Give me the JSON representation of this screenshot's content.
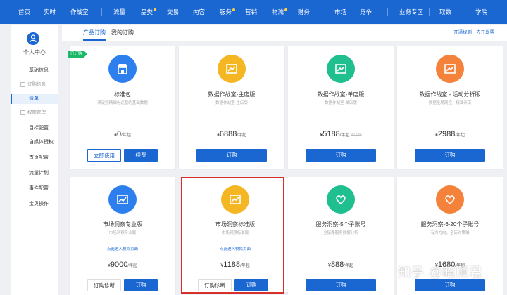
{
  "nav": {
    "items": [
      "首页",
      "实时",
      "作战室",
      "流量",
      "品类",
      "交易",
      "内容",
      "服务",
      "营销",
      "物流",
      "财务",
      "市场",
      "竞争",
      "业务专区",
      "取数",
      "学院"
    ]
  },
  "sidebar": {
    "user_label": "个人中心",
    "basic_info": "基础信息",
    "order_group": "订购信息",
    "order_item": "清单",
    "settings_group": "权限管理",
    "items": [
      "目标配置",
      "自媒体授权",
      "首页配置",
      "流量计划",
      "事件配置",
      "宝贝操作"
    ]
  },
  "header": {
    "tab_products": "产品订购",
    "tab_my_orders": "我的订购",
    "link_rules": "开通规则",
    "link_invoice": "去开发票"
  },
  "cards": [
    {
      "badge": "已订购",
      "title": "标准包",
      "sub": "满足您精细化运营的基础数据",
      "currency": "¥",
      "price": "0",
      "unit": "/年起",
      "btn_left": "立即使用",
      "btn_right": "续费",
      "icon": "store-icon",
      "color": "#2d7fee"
    },
    {
      "title": "数据作战室-主店版",
      "sub": "数据作战室·主店版",
      "currency": "¥",
      "price": "6888",
      "unit": "/年起",
      "btn": "订购",
      "icon": "chart-icon",
      "color": "#f4b623"
    },
    {
      "title": "数据作战室-单店版",
      "sub": "数据作战室·单店版",
      "currency": "¥",
      "price": "5188",
      "unit": "/年起",
      "old_price": "¥6,188",
      "btn": "订购",
      "icon": "chart-icon",
      "color": "#1fbf8f"
    },
    {
      "title": "数据作战室 - 活动分析版",
      "sub": "数据全局观控，精准开店",
      "currency": "¥",
      "price": "2988",
      "unit": "/年起",
      "btn": "订购",
      "icon": "chart-icon",
      "color": "#f5823a"
    },
    {
      "title": "市场洞察专业版",
      "sub": "市场洞察专业版",
      "link": "点此进入模拟页面",
      "currency": "¥",
      "price": "9000",
      "unit": "/年起",
      "btn_left": "订购诊断",
      "btn_right": "订购",
      "icon": "trend-icon",
      "color": "#2d7fee"
    },
    {
      "title": "市场洞察标准版",
      "sub": "市场洞察标准版",
      "link": "点此进入模拟页面",
      "currency": "¥",
      "price": "1188",
      "unit": "/年起",
      "btn_left": "订购诊断",
      "btn_right": "订购",
      "icon": "chart-icon",
      "color": "#f4b623"
    },
    {
      "title": "服务洞察-5个子账号",
      "sub": "全链路服务数据分析",
      "currency": "¥",
      "price": "888",
      "unit": "/年起",
      "btn": "订购",
      "icon": "heart-icon",
      "color": "#1fbf8f"
    },
    {
      "title": "服务洞察-6-20个子账号",
      "sub": "有力方向，全店对策略",
      "currency": "¥",
      "price": "1680",
      "unit": "/年起",
      "btn": "订购",
      "icon": "heart-icon",
      "color": "#f5823a"
    }
  ],
  "watermark": "知乎 @昭顾君"
}
